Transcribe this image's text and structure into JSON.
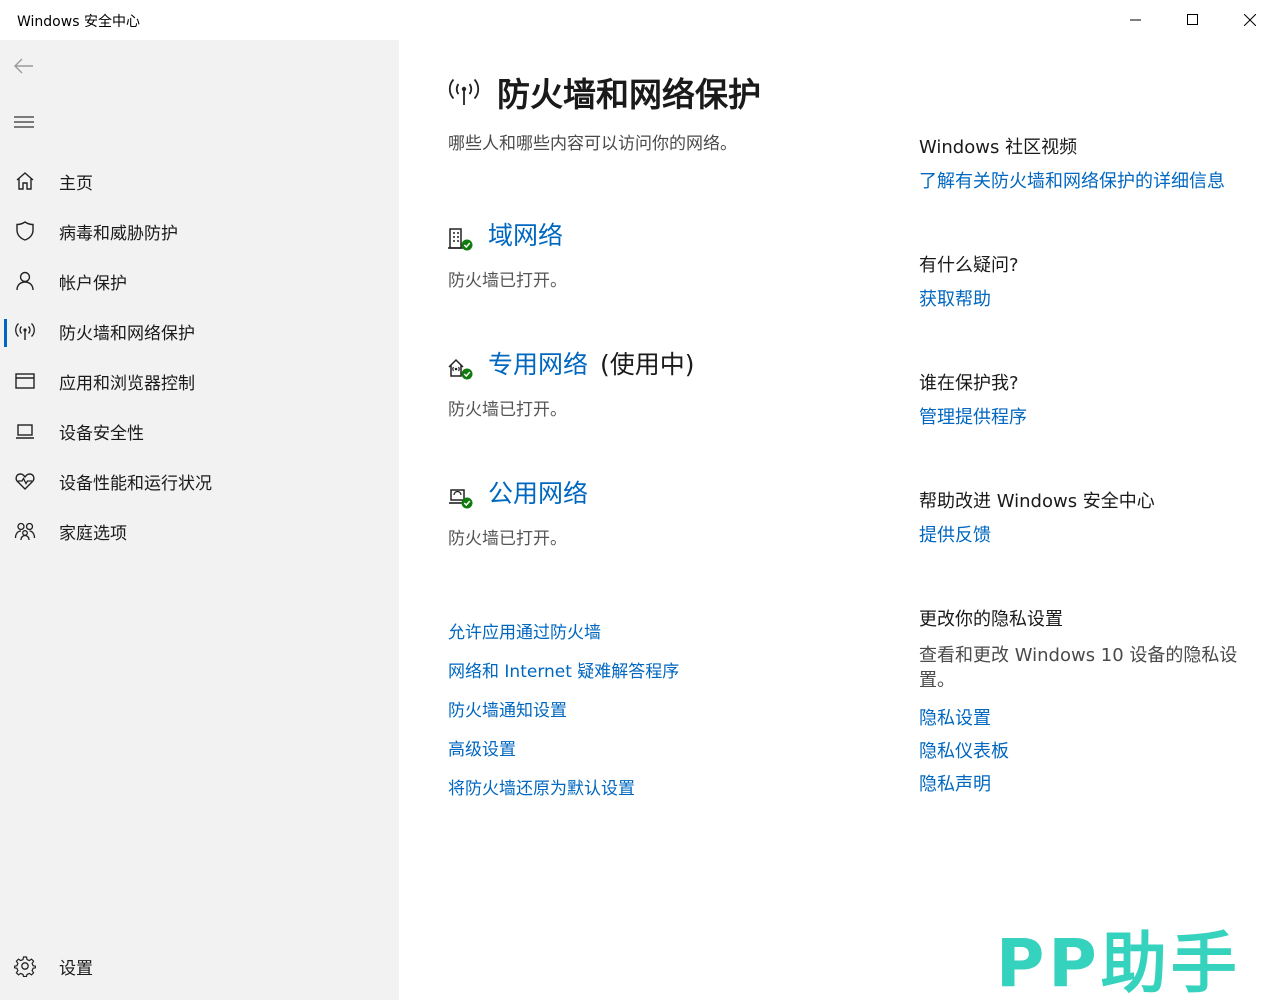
{
  "window": {
    "title": "Windows 安全中心"
  },
  "sidebar": {
    "items": [
      {
        "label": "主页",
        "icon": "home-icon"
      },
      {
        "label": "病毒和威胁防护",
        "icon": "shield-icon"
      },
      {
        "label": "帐户保护",
        "icon": "person-icon"
      },
      {
        "label": "防火墙和网络保护",
        "icon": "wifi-antenna-icon"
      },
      {
        "label": "应用和浏览器控制",
        "icon": "browser-window-icon"
      },
      {
        "label": "设备安全性",
        "icon": "laptop-icon"
      },
      {
        "label": "设备性能和运行状况",
        "icon": "heart-pulse-icon"
      },
      {
        "label": "家庭选项",
        "icon": "family-icon"
      }
    ],
    "settings_label": "设置",
    "active_index": 3
  },
  "main": {
    "title": "防火墙和网络保护",
    "subtitle": "哪些人和哪些内容可以访问你的网络。",
    "networks": [
      {
        "name": "域网络",
        "in_use": "",
        "status": "防火墙已打开。",
        "icon": "domain-network-icon"
      },
      {
        "name": "专用网络",
        "in_use": "(使用中)",
        "status": "防火墙已打开。",
        "icon": "private-network-icon"
      },
      {
        "name": "公用网络",
        "in_use": "",
        "status": "防火墙已打开。",
        "icon": "public-network-icon"
      }
    ],
    "links": [
      "允许应用通过防火墙",
      "网络和 Internet 疑难解答程序",
      "防火墙通知设置",
      "高级设置",
      "将防火墙还原为默认设置"
    ]
  },
  "side_panel": {
    "community": {
      "heading": "Windows 社区视频",
      "link": "了解有关防火墙和网络保护的详细信息"
    },
    "question": {
      "heading": "有什么疑问?",
      "link": "获取帮助"
    },
    "protector": {
      "heading": "谁在保护我?",
      "link": "管理提供程序"
    },
    "improve": {
      "heading": "帮助改进 Windows 安全中心",
      "link": "提供反馈"
    },
    "privacy": {
      "heading": "更改你的隐私设置",
      "text": "查看和更改 Windows 10 设备的隐私设置。",
      "links": [
        "隐私设置",
        "隐私仪表板",
        "隐私声明"
      ]
    }
  },
  "watermark": "PP助手",
  "colors": {
    "accent": "#0067c0",
    "status_ok": "#107c10",
    "sidebar_bg": "#f2f2f2",
    "watermark": "#35d3bd"
  }
}
